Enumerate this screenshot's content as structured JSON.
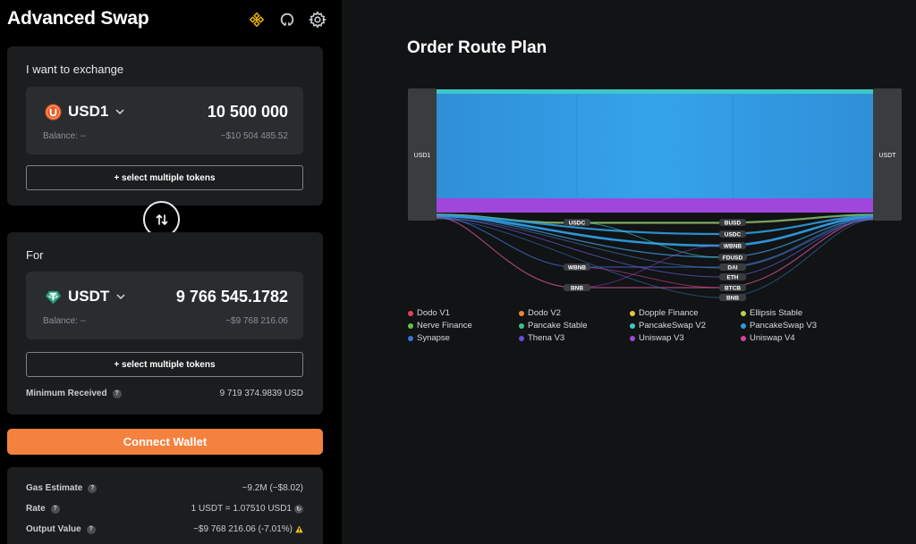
{
  "app": {
    "title": "Advanced Swap",
    "header_icons": [
      "bnb-chain-icon",
      "github-icon",
      "settings-gear-icon"
    ]
  },
  "exchange": {
    "label": "I want to exchange",
    "token": "USD1",
    "token_icon": "usd1-coin-icon",
    "token_color": "#ea5a1f",
    "amount": "10 500 000",
    "balance": "Balance: --",
    "usd_value": "~$10 504 485.52",
    "multi_button": "+ select multiple tokens"
  },
  "receive": {
    "label": "For",
    "token": "USDT",
    "token_icon": "tether-icon",
    "token_color": "#26a17b",
    "amount": "9 766 545.1782",
    "balance": "Balance: --",
    "usd_value": "~$9 768 216.06",
    "multi_button": "+ select multiple tokens",
    "min_received_label": "Minimum Received",
    "min_received_value": "9 719 374.9839 USD"
  },
  "connect_button": "Connect Wallet",
  "summary": {
    "gas_label": "Gas Estimate",
    "gas_value": "~9.2M (~$8.02)",
    "rate_label": "Rate",
    "rate_value": "1 USDT = 1.07510 USD1",
    "output_label": "Output Value",
    "output_value": "~$9 768 216.06 (-7.01%)"
  },
  "route": {
    "title": "Order Route Plan",
    "source": "USD1",
    "target": "USDT",
    "left_intermediates": [
      "USDC",
      "WBNB",
      "BNB"
    ],
    "right_intermediates": [
      "BUSD",
      "USDC",
      "WBNB",
      "FDUSD",
      "DAI",
      "ETH",
      "BTCB",
      "BNB"
    ]
  },
  "legend": [
    {
      "name": "Dodo V1",
      "color": "#e0455b"
    },
    {
      "name": "Dodo V2",
      "color": "#f0862d"
    },
    {
      "name": "Dopple Finance",
      "color": "#e9c43a"
    },
    {
      "name": "Ellipsis Stable",
      "color": "#b9d34a"
    },
    {
      "name": "Nerve Finance",
      "color": "#5ec24d"
    },
    {
      "name": "Pancake Stable",
      "color": "#3fbf88"
    },
    {
      "name": "PancakeSwap V2",
      "color": "#3cc8c8"
    },
    {
      "name": "PancakeSwap V3",
      "color": "#2f9be0"
    },
    {
      "name": "Synapse",
      "color": "#3c6fdc"
    },
    {
      "name": "Thena V3",
      "color": "#6a4fd6"
    },
    {
      "name": "Uniswap V3",
      "color": "#a046dc"
    },
    {
      "name": "Uniswap V4",
      "color": "#d5449a"
    }
  ]
}
